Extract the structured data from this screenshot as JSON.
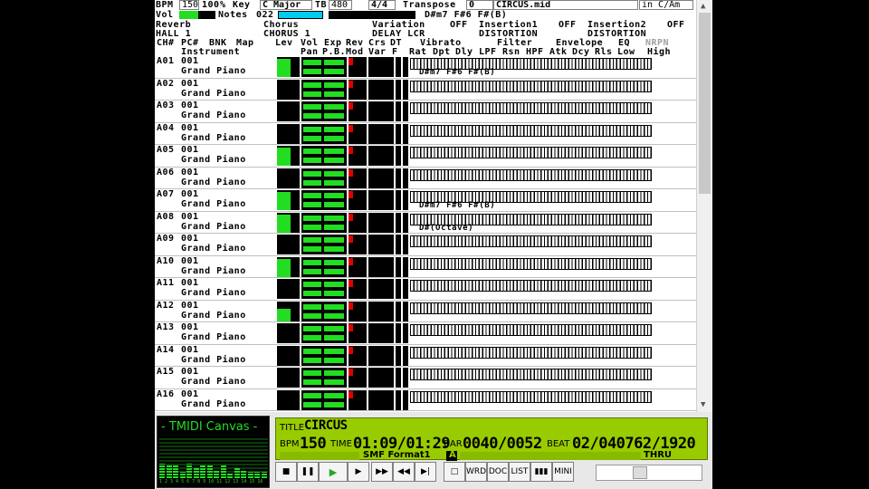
{
  "header": {
    "bpm_label": "BPM",
    "bpm_value": "150",
    "percent_value": "100",
    "percent_sign": "%",
    "key_label": "Key",
    "key_value": "C  Major",
    "tb_label": "TB",
    "tb_value": "480",
    "time_sig": "4/4",
    "transpose_label": "Transpose",
    "transpose_value": "0",
    "file_name": "CIRCUS.mid",
    "ext_mode": "in C/Am",
    "vol_label": "Vol",
    "notes_label": "Notes",
    "notes_value": "022",
    "chord_display": "D#m7 F#6 F#(B)"
  },
  "effects": {
    "reverb_label": "Reverb",
    "reverb_value": "HALL 1",
    "chorus_label": "Chorus",
    "chorus_value": "CHORUS 1",
    "variation_label": "Variation",
    "variation_state": "OFF",
    "variation_value": "DELAY LCR",
    "insertion1_label": "Insertion1",
    "insertion1_state": "OFF",
    "insertion1_value": "DISTORTION",
    "insertion2_label": "Insertion2",
    "insertion2_state": "OFF",
    "insertion2_value": "DISTORTION"
  },
  "columns": {
    "row1": [
      "CH#",
      "PC#",
      "BNK",
      "Map",
      "Lev",
      "Vol",
      "Exp",
      "Rev",
      "Crs",
      "DT",
      "Vibrato",
      "Filter",
      "Envelope",
      "EQ",
      "NRPN"
    ],
    "row2": [
      "Instrument",
      "Pan",
      "P.B.",
      "Mod",
      "Var",
      "F",
      "Rat",
      "Dpt",
      "Dly",
      "LPF",
      "Rsn",
      "HPF",
      "Atk",
      "Dcy",
      "Rls",
      "Low",
      "High"
    ]
  },
  "channels": [
    {
      "ch": "A01",
      "pc": "001",
      "inst": "Grand Piano",
      "level": 0.9,
      "chord": "D#m7 F#6 F#(B)"
    },
    {
      "ch": "A02",
      "pc": "001",
      "inst": "Grand Piano",
      "level": 0.0,
      "chord": ""
    },
    {
      "ch": "A03",
      "pc": "001",
      "inst": "Grand Piano",
      "level": 0.0,
      "chord": ""
    },
    {
      "ch": "A04",
      "pc": "001",
      "inst": "Grand Piano",
      "level": 0.0,
      "chord": ""
    },
    {
      "ch": "A05",
      "pc": "001",
      "inst": "Grand Piano",
      "level": 0.9,
      "chord": ""
    },
    {
      "ch": "A06",
      "pc": "001",
      "inst": "Grand Piano",
      "level": 0.0,
      "chord": ""
    },
    {
      "ch": "A07",
      "pc": "001",
      "inst": "Grand Piano",
      "level": 0.9,
      "chord": "D#m7 F#6 F#(B)"
    },
    {
      "ch": "A08",
      "pc": "001",
      "inst": "Grand Piano",
      "level": 0.9,
      "chord": "D#(Octave)"
    },
    {
      "ch": "A09",
      "pc": "001",
      "inst": "Grand Piano",
      "level": 0.0,
      "chord": ""
    },
    {
      "ch": "A10",
      "pc": "001",
      "inst": "Grand Piano",
      "level": 0.9,
      "chord": ""
    },
    {
      "ch": "A11",
      "pc": "001",
      "inst": "Grand Piano",
      "level": 0.0,
      "chord": ""
    },
    {
      "ch": "A12",
      "pc": "001",
      "inst": "Grand Piano",
      "level": 0.6,
      "chord": ""
    },
    {
      "ch": "A13",
      "pc": "001",
      "inst": "Grand Piano",
      "level": 0.0,
      "chord": ""
    },
    {
      "ch": "A14",
      "pc": "001",
      "inst": "Grand Piano",
      "level": 0.0,
      "chord": ""
    },
    {
      "ch": "A15",
      "pc": "001",
      "inst": "Grand Piano",
      "level": 0.0,
      "chord": ""
    },
    {
      "ch": "A16",
      "pc": "001",
      "inst": "Grand Piano",
      "level": 0.0,
      "chord": ""
    }
  ],
  "canvas": {
    "title": "- TMIDI Canvas -",
    "channel_numbers": "1 2 3 4 5 6 7 8 9 10 11 12 13 14 15 16"
  },
  "lcd": {
    "title_label": "TITLE",
    "title_value": "CIRCUS",
    "bpm_label": "BPM",
    "bpm_value": "150",
    "time_label": "TIME",
    "time_value": "01:09/01:29",
    "bar_label": "BAR",
    "bar_value": "0040/0052",
    "beat_label": "BEAT",
    "beat_value": "02/040762/1920",
    "format_value": "SMF Format1",
    "port_value": "A",
    "thru_value": "THRU"
  },
  "transport": {
    "wrd": "WRD",
    "doc": "DOC",
    "list": "LIST",
    "mini": "MINI"
  },
  "colors": {
    "lcd_background": "#99cc00",
    "level_green": "#22dd22",
    "note_red": "#e00000",
    "vol_cyan": "#00ccee"
  }
}
